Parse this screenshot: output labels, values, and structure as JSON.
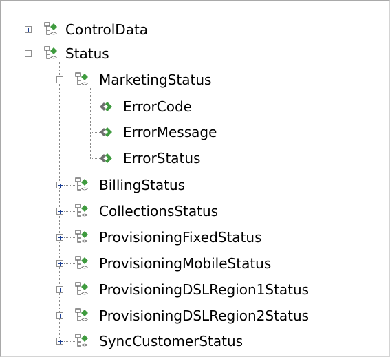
{
  "tree": {
    "nodes": [
      {
        "label": "ControlData",
        "state": "collapsed",
        "icon": "structure-icon"
      },
      {
        "label": "Status",
        "state": "expanded",
        "icon": "structure-icon"
      },
      {
        "label": "MarketingStatus",
        "state": "expanded",
        "icon": "structure-icon"
      },
      {
        "label": "ErrorCode",
        "state": "leaf",
        "icon": "element-icon"
      },
      {
        "label": "ErrorMessage",
        "state": "leaf",
        "icon": "element-icon"
      },
      {
        "label": "ErrorStatus",
        "state": "leaf",
        "icon": "element-icon"
      },
      {
        "label": "BillingStatus",
        "state": "collapsed",
        "icon": "structure-icon"
      },
      {
        "label": "CollectionsStatus",
        "state": "collapsed",
        "icon": "structure-icon"
      },
      {
        "label": "ProvisioningFixedStatus",
        "state": "collapsed",
        "icon": "structure-icon"
      },
      {
        "label": "ProvisioningMobileStatus",
        "state": "collapsed",
        "icon": "structure-icon"
      },
      {
        "label": "ProvisioningDSLRegion1Status",
        "state": "collapsed",
        "icon": "structure-icon"
      },
      {
        "label": "ProvisioningDSLRegion2Status",
        "state": "collapsed",
        "icon": "structure-icon"
      },
      {
        "label": "SyncCustomerStatus",
        "state": "collapsed",
        "icon": "structure-icon"
      }
    ]
  },
  "colors": {
    "icon_green": "#3f9b3f",
    "icon_gray": "#6f6f6f",
    "line": "#8a8a8a",
    "expander_sign": "#1c3f94"
  }
}
